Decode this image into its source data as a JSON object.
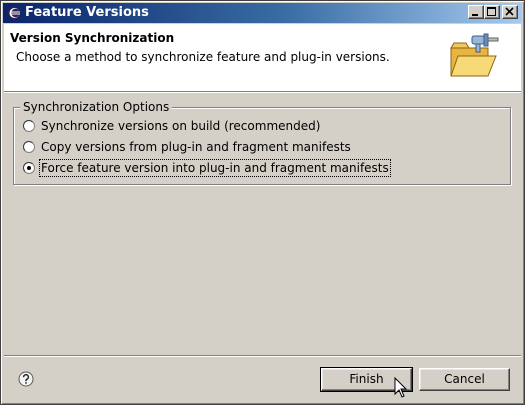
{
  "window": {
    "title": "Feature Versions",
    "icon": "eclipse-icon",
    "controls": [
      "minimize-icon",
      "maximize-icon",
      "close-icon"
    ]
  },
  "header": {
    "title": "Version Synchronization",
    "description": "Choose a method to synchronize feature and plug-in versions.",
    "graphic": "folder-plugin-icon"
  },
  "group": {
    "legend": "Synchronization Options",
    "options": [
      {
        "label": "Synchronize versions on build (recommended)",
        "selected": false
      },
      {
        "label": "Copy versions from plug-in and fragment manifests",
        "selected": false
      },
      {
        "label": "Force feature version into plug-in and fragment manifests",
        "selected": true
      }
    ]
  },
  "footer": {
    "help_icon": "help-icon",
    "finish_label": "Finish",
    "cancel_label": "Cancel"
  },
  "colors": {
    "titlebar_start": "#0a246a",
    "titlebar_end": "#a6caf0",
    "dialog_bg": "#d4d0c8"
  }
}
